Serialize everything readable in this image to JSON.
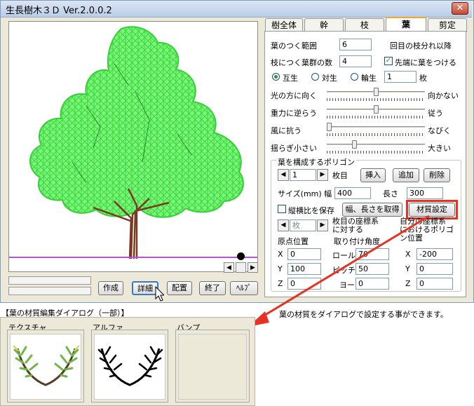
{
  "window": {
    "title": "生長樹木３Ｄ Ver.2.0.0.2",
    "close": "✕"
  },
  "tabs": [
    "樹全体",
    "幹",
    "枝",
    "葉",
    "剪定"
  ],
  "active_tab": "葉",
  "leaf": {
    "range_label": "葉のつく範囲",
    "range_value": "6",
    "range_suffix": "回目の枝分れ以降",
    "group_count_label": "枝につく葉群の数",
    "group_count_value": "4",
    "tip_leaf_label": "先端に葉をつける",
    "tip_leaf_checked": "✓",
    "arrangement": [
      "互生",
      "対生",
      "輪生"
    ],
    "arrangement_selected": "互生",
    "whorl_value": "1",
    "whorl_suffix": "枚"
  },
  "sliders": [
    {
      "left": "光の方に向く",
      "right": "向かない",
      "level": 0.5
    },
    {
      "left": "重力に逆らう",
      "right": "従う",
      "level": 0.5
    },
    {
      "left": "風に抗う",
      "right": "なびく",
      "level": 0.0
    },
    {
      "left": "揺らぎ小さい",
      "right": "大きい",
      "level": 0.27
    }
  ],
  "polygon": {
    "group_title": "葉を構成するポリゴン",
    "index_value": "1",
    "index_suffix": "枚目",
    "insert": "挿入",
    "add": "追加",
    "delete": "削除",
    "size_label": "サイズ(mm) 幅",
    "width_value": "400",
    "length_label": "長さ",
    "length_value": "300",
    "keep_ratio": "縦横比を保存",
    "get_size": "幅、長さを取得",
    "material": "材質設定",
    "coord_index": "枚",
    "coord_text": "枚目の座標系\nに対する",
    "self_coord_text": "自分の座標系\nにおけるポリゴ\nン位置",
    "origin_title": "原点位置",
    "angle_title": "取り付け角度",
    "x_label": "X",
    "y_label": "Y",
    "z_label": "Z",
    "origin_x": "0",
    "origin_y": "100",
    "origin_z": "0",
    "roll_label": "ロール",
    "pitch_label": "ピッチ",
    "yaw_label": "ヨー",
    "roll": "70",
    "pitch": "50",
    "yaw": "0",
    "self_x": "-200",
    "self_y": "0",
    "self_z": "0"
  },
  "bottom_buttons": [
    "作成",
    "詳細",
    "配置",
    "終了",
    "ﾍﾙﾌﾟ"
  ],
  "annotation": "葉の材質をダイアログで設定する事ができます。",
  "dialog": {
    "caption": "【葉の材質編集ダイアログ（一部）】",
    "panes": [
      "テクスチャ",
      "アルファ",
      "バンプ"
    ]
  },
  "colors": {
    "foliage": "#5cf05c",
    "trunk": "#7a3a22",
    "highlight": "#e53222",
    "ground": "#b455d6"
  }
}
